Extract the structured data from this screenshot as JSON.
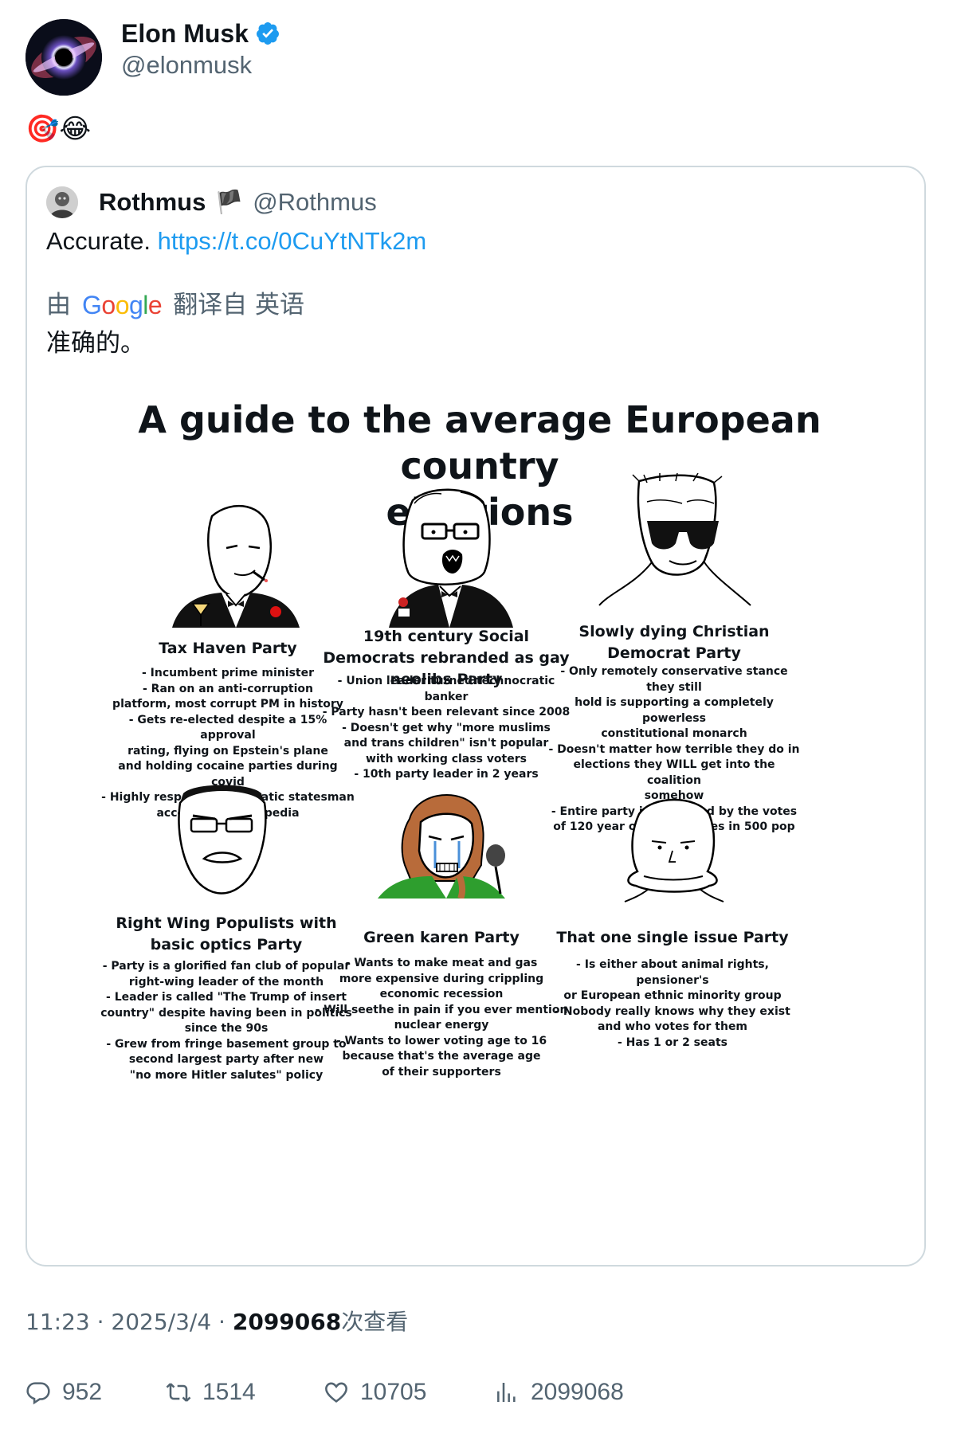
{
  "tweet": {
    "author_name": "Elon Musk",
    "author_handle": "@elonmusk",
    "text": "🎯😂",
    "timestamp": "11:23 · 2025/3/4 · ",
    "views_count": "2099068",
    "views_label": "次查看"
  },
  "quote": {
    "author_name": "Rothmus",
    "author_flag": "🏴",
    "author_handle": "@Rothmus",
    "text": "Accurate.",
    "link": "https://t.co/0CuYtNTk2m",
    "translate_prefix": "由",
    "translate_brand": "Google",
    "translate_suffix": "翻译自 英语",
    "translated_text": "准确的。"
  },
  "meme": {
    "title_line1": "A guide to the average European country",
    "title_line2": "elections",
    "panels": [
      {
        "title": "Tax Haven Party",
        "desc": "- Incumbent prime minister\n- Ran on an anti-corruption\nplatform, most corrupt PM in history\n- Gets re-elected despite a 15% approval\nrating, flying on Epstein's plane\nand holding cocaine parties during covid\n- Highly respected pragmatic statesman\naccording to wikipedia"
      },
      {
        "title": "19th century Social Democrats\nrebranded as gay neolibs Party",
        "desc": "- Union leader turned technocratic\nbanker\n- Party hasn't been relevant since 2008\n- Doesn't get why \"more muslims\nand trans children\" isn't popular\nwith working class voters\n- 10th party leader in 2 years"
      },
      {
        "title": "Slowly dying Christian\nDemocrat Party",
        "desc": "- Only remotely conservative stance they still\nhold is supporting a completely powerless\nconstitutional monarch\n- Doesn't matter how terrible they do in\nelections they WILL get into the coalition\nsomehow\n- Entire party is sustained by the votes\nof 120 year old elder liches in 500 pop\nvillages"
      },
      {
        "title": "Right Wing Populists with\nbasic optics Party",
        "desc": "- Party is a glorified fan club of popular\nright-wing leader of the month\n- Leader is called \"The Trump of insert\ncountry\" despite having been in politics\nsince the 90s\n- Grew from fringe basement group to\nsecond largest party after new\n\"no more Hitler salutes\" policy"
      },
      {
        "title": "Green karen Party",
        "desc": "- Wants to make meat and gas\nmore expensive during crippling\neconomic recession\n- Will seethe in pain if you ever mention\nnuclear energy\n- Wants to lower voting age to 16\nbecause that's the average age\nof their supporters"
      },
      {
        "title": "That one single issue Party",
        "desc": "- Is either about animal rights, pensioner's\nor European ethnic minority group\n- Nobody really knows why they exist\nand who votes for them\n- Has 1 or 2 seats"
      }
    ]
  },
  "actions": {
    "replies": "952",
    "reposts": "1514",
    "likes": "10705",
    "views": "2099068"
  },
  "icons": [
    "verified-badge-icon",
    "flag-icon",
    "reply-icon",
    "repost-icon",
    "like-icon",
    "views-icon"
  ],
  "colors": {
    "link": "#1d9bf0",
    "verified": "#1d9bf0",
    "muted": "#536471",
    "border": "#cfd9de"
  }
}
